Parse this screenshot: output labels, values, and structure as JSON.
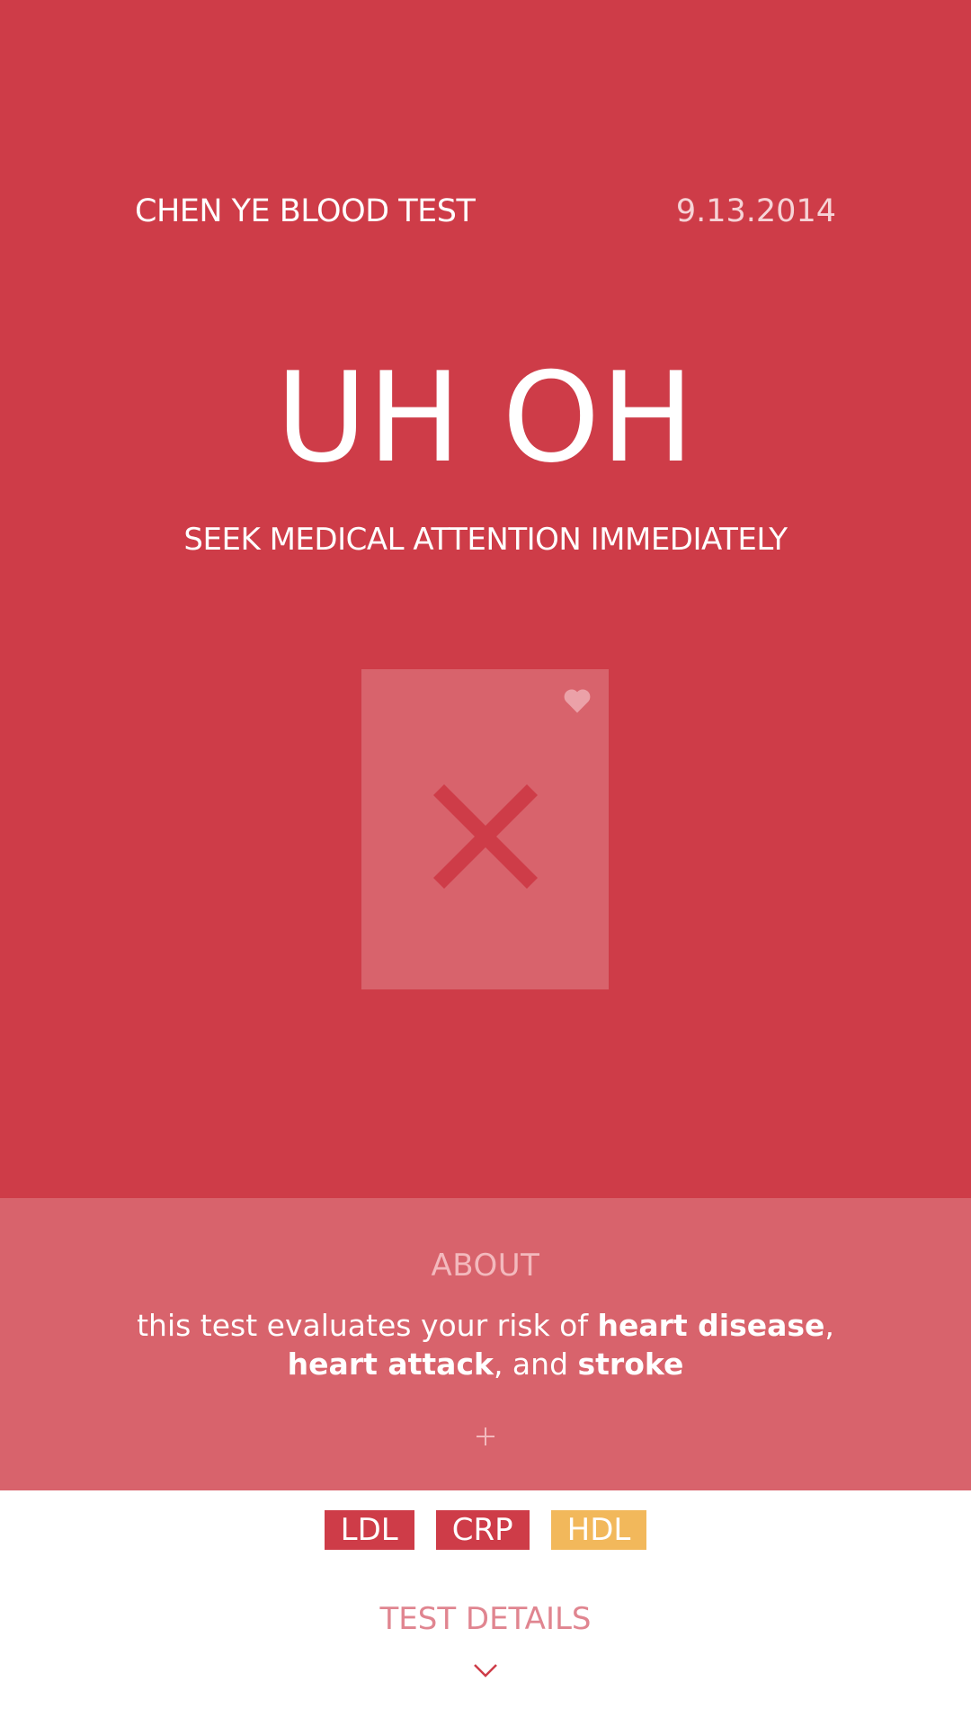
{
  "header": {
    "title": "CHEN YE BLOOD TEST",
    "date": "9.13.2014"
  },
  "result": {
    "headline": "UH OH",
    "subheadline": "SEEK MEDICAL ATTENTION IMMEDIATELY",
    "card_icons": [
      "heart-icon",
      "x-mark-icon"
    ]
  },
  "about": {
    "title": "ABOUT",
    "text_parts": {
      "p1": "this test evaluates your risk of ",
      "b1": "heart disease",
      "p2": ",",
      "b2": "heart attack",
      "p3": ", and ",
      "b3": "stroke"
    },
    "expand_icon": "plus-icon"
  },
  "tags": [
    {
      "label": "LDL",
      "color": "#ce3c48"
    },
    {
      "label": "CRP",
      "color": "#ce3c48"
    },
    {
      "label": "HDL",
      "color": "#f2b85b"
    }
  ],
  "details": {
    "title": "TEST DETAILS",
    "icon": "chevron-down-icon"
  },
  "colors": {
    "primary_red": "#ce3c48",
    "light_red": "#d8636c",
    "amber": "#f2b85b"
  }
}
